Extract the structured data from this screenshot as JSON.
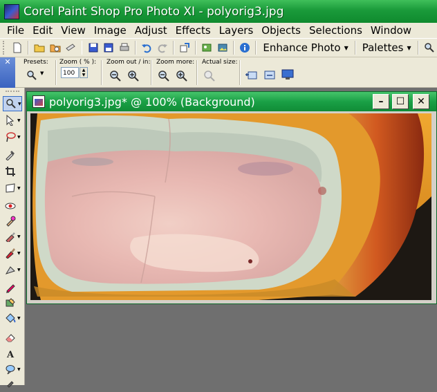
{
  "window": {
    "title": "Corel Paint Shop Pro Photo XI - polyorig3.jpg"
  },
  "menu": [
    "File",
    "Edit",
    "View",
    "Image",
    "Adjust",
    "Effects",
    "Layers",
    "Objects",
    "Selections",
    "Window"
  ],
  "toolbar": {
    "enhance_label": "Enhance Photo",
    "palettes_label": "Palettes"
  },
  "tool_options": {
    "close_glyph": "✕",
    "presets_label": "Presets:",
    "zoom_label": "Zoom ( % ):",
    "zoom_value": "100",
    "zoom_out_in_label": "Zoom out / in:",
    "zoom_more_label": "Zoom more:",
    "actual_size_label": "Actual size:"
  },
  "document": {
    "title": "polyorig3.jpg* @ 100% (Background)",
    "minimize_glyph": "–",
    "maximize_glyph": "☐",
    "close_glyph": "✕"
  },
  "colors": {
    "accent_green": "#1a9a3a",
    "chrome": "#ece9d8",
    "workspace": "#6f6f6f"
  }
}
